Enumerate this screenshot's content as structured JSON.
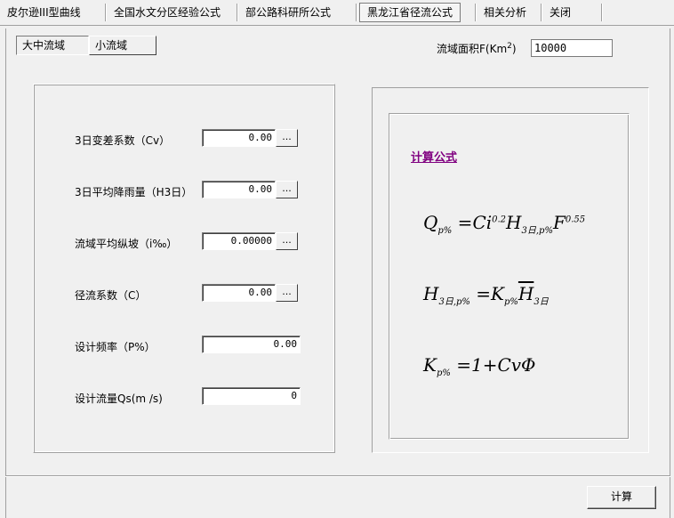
{
  "menu": {
    "items": [
      {
        "label": "皮尔逊III型曲线",
        "active": false
      },
      {
        "label": "全国水文分区经验公式",
        "active": false
      },
      {
        "label": "部公路科研所公式",
        "active": false
      },
      {
        "label": "黑龙江省径流公式",
        "active": true
      },
      {
        "label": "相关分析",
        "active": false
      },
      {
        "label": "关闭",
        "active": false
      }
    ]
  },
  "subtabs": {
    "items": [
      {
        "label": "大中流域",
        "active": true
      },
      {
        "label": "小流域",
        "active": false
      }
    ]
  },
  "area": {
    "label_main": "流域面积F(Km",
    "label_sup": "2",
    "label_tail": ")",
    "value": "10000"
  },
  "params": [
    {
      "label": "3日变差系数（Cv）",
      "value": "0.00",
      "has_button": true
    },
    {
      "label": "3日平均降雨量（H3日）",
      "value": "0.00",
      "has_button": true
    },
    {
      "label": "流域平均纵坡（i‰）",
      "value": "0.00000",
      "has_button": true
    },
    {
      "label": "径流系数（C）",
      "value": "0.00",
      "has_button": true
    },
    {
      "label": "设计频率（P%）",
      "value": "0.00",
      "has_button": false
    },
    {
      "label": "设计流量Qs(m /s)",
      "value": "0",
      "has_button": false
    }
  ],
  "dots_label": "...",
  "formula": {
    "title": "计算公式",
    "f1": {
      "q": "Q",
      "qsub": "p%",
      "eq": " =",
      "ci": "Ci",
      "exp1": "0.2",
      "h": "H",
      "hsub": "3日,p%",
      "f": "F",
      "exp2": "0.55"
    },
    "f2": {
      "h": "H",
      "hsub": "3日,p%",
      "eq": " =",
      "k": "K",
      "ksub": "p%",
      "hbar": "H",
      "hbarsub": "3日"
    },
    "f3": {
      "k": "K",
      "ksub": "p%",
      "rest": " =1+CvΦ"
    }
  },
  "calc_button": "计算"
}
